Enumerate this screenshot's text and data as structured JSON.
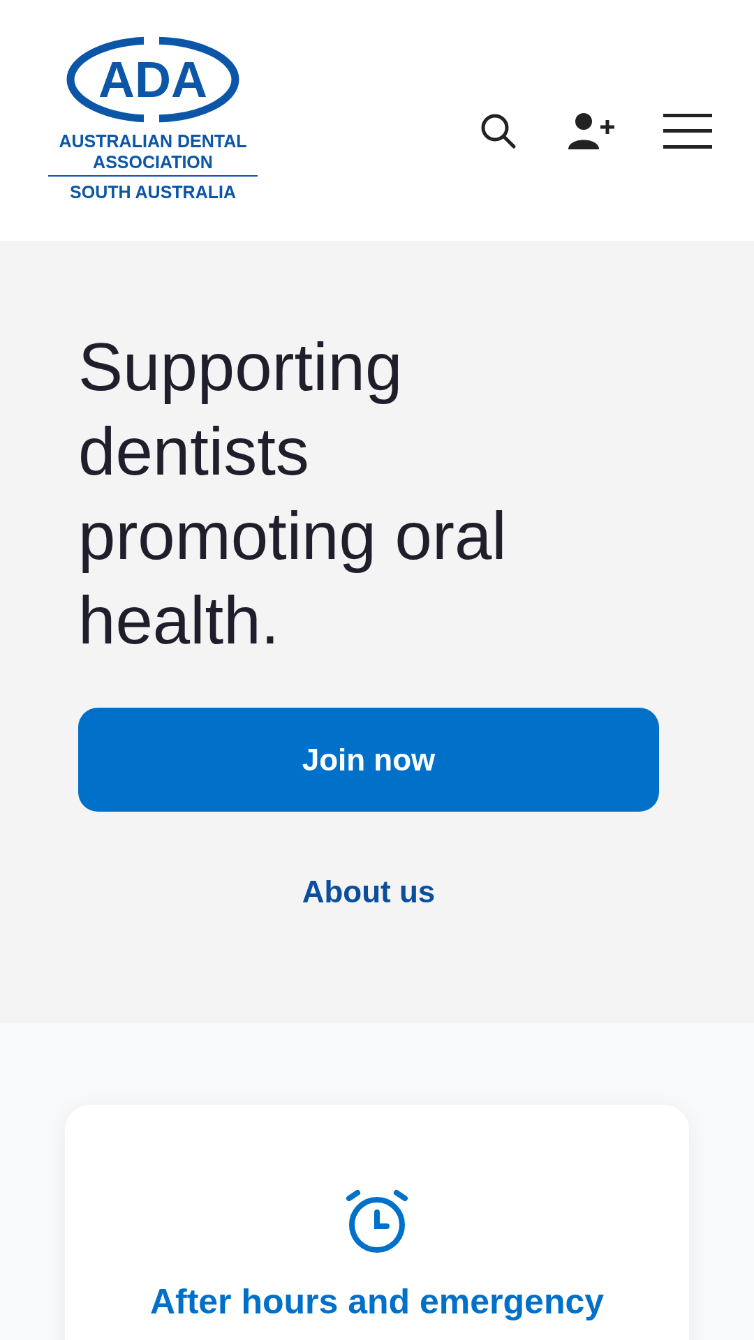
{
  "header": {
    "logo": {
      "mark": "ADA",
      "lines": [
        "AUSTRALIAN DENTAL",
        "ASSOCIATION"
      ],
      "region": "SOUTH AUSTRALIA"
    }
  },
  "hero": {
    "title": "Supporting dentists promoting oral health.",
    "primary_button": "Join now",
    "secondary_link": "About us"
  },
  "cards": [
    {
      "title": "After hours and emergency"
    }
  ]
}
